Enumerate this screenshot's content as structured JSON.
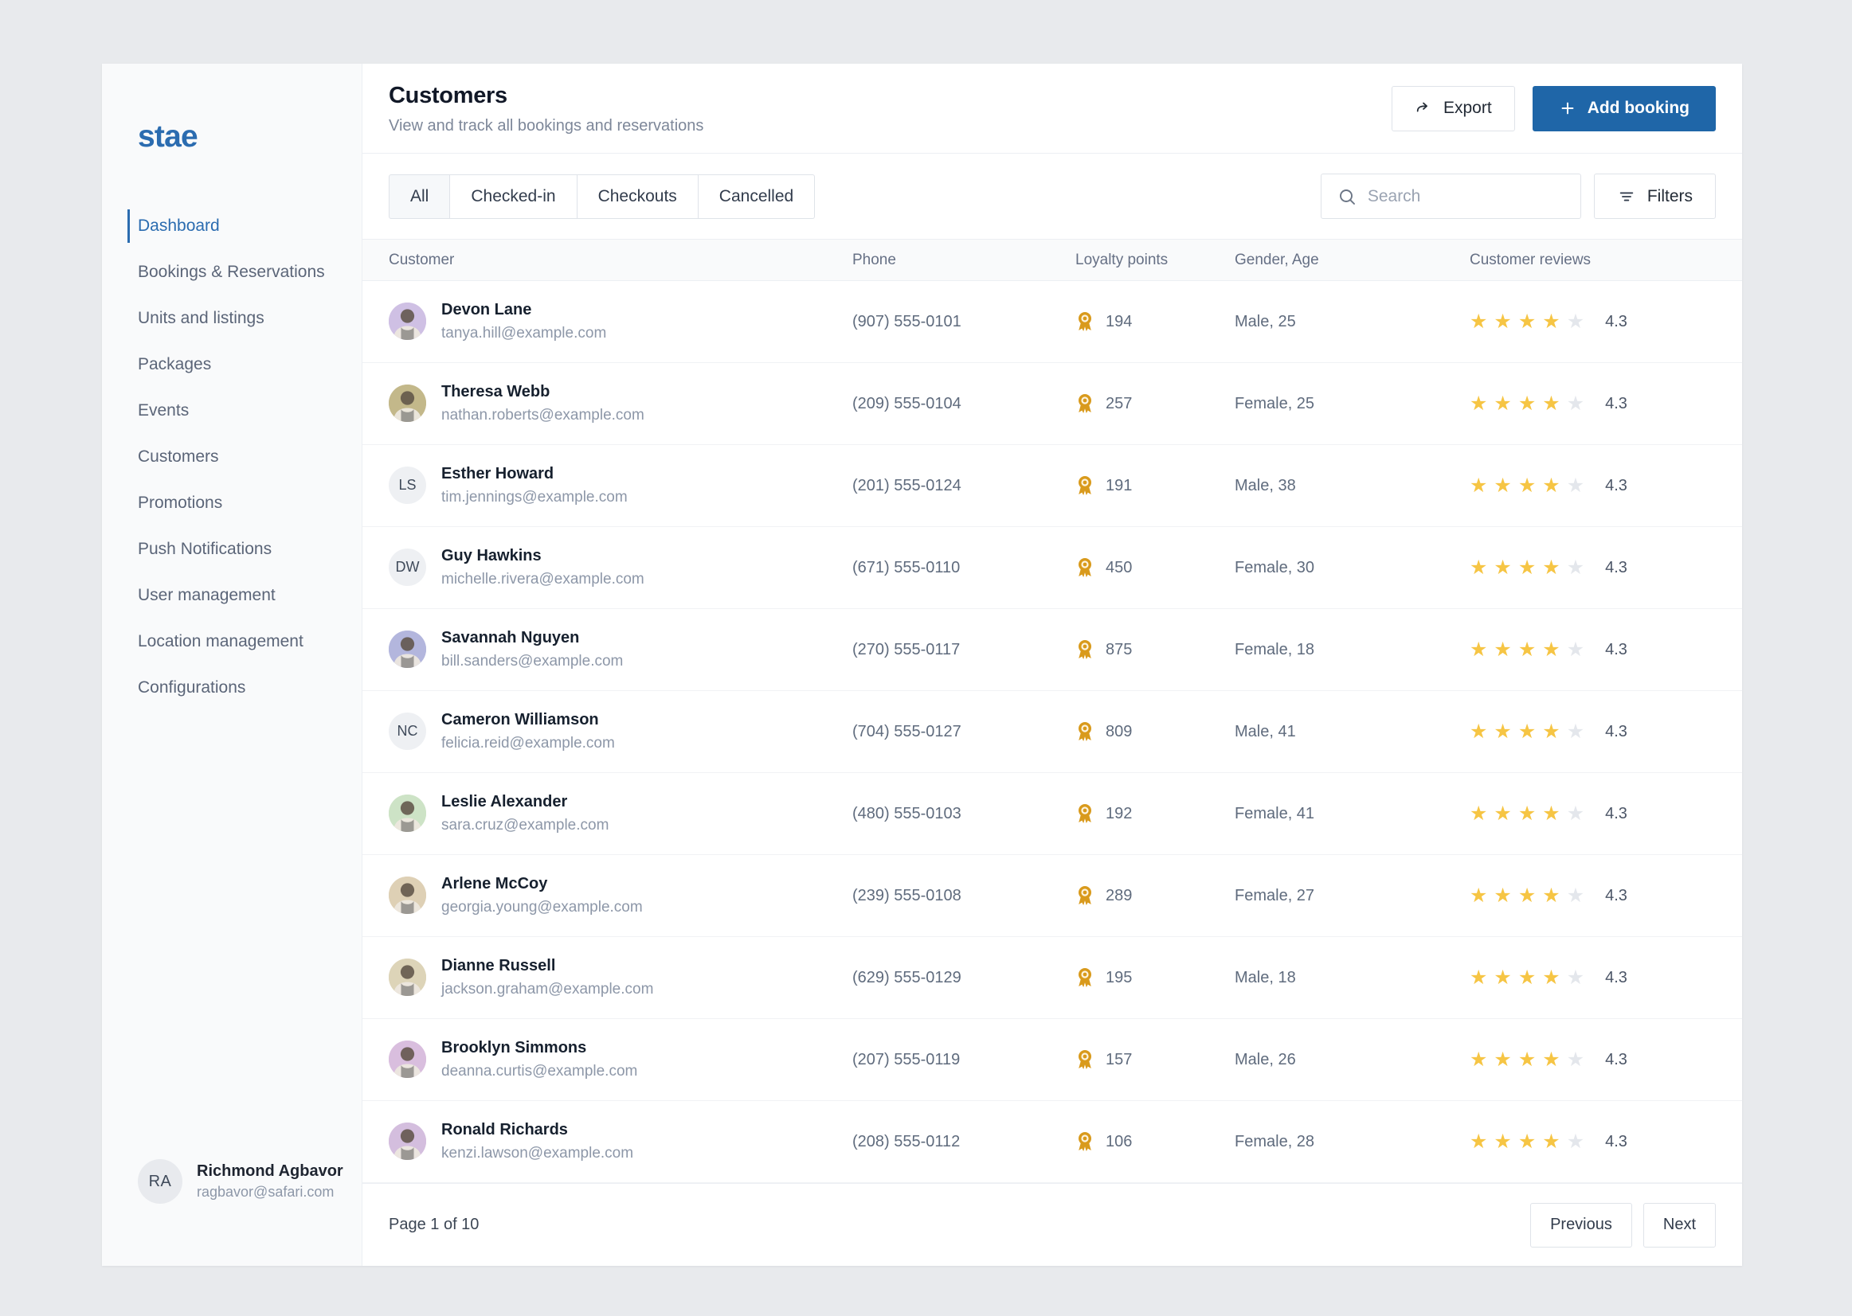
{
  "brand": {
    "logo_text": "stae"
  },
  "sidebar": {
    "items": [
      {
        "label": "Dashboard",
        "active": true
      },
      {
        "label": "Bookings & Reservations",
        "active": false
      },
      {
        "label": "Units and listings",
        "active": false
      },
      {
        "label": "Packages",
        "active": false
      },
      {
        "label": "Events",
        "active": false
      },
      {
        "label": "Customers",
        "active": false
      },
      {
        "label": "Promotions",
        "active": false
      },
      {
        "label": "Push Notifications",
        "active": false
      },
      {
        "label": "User management",
        "active": false
      },
      {
        "label": "Location management",
        "active": false
      },
      {
        "label": "Configurations",
        "active": false
      }
    ],
    "profile": {
      "initials": "RA",
      "name": "Richmond Agbavor",
      "email": "ragbavor@safari.com"
    }
  },
  "header": {
    "title": "Customers",
    "subtitle": "View and track all bookings and reservations",
    "export_label": "Export",
    "add_booking_label": "Add booking"
  },
  "toolbar": {
    "tabs": [
      {
        "label": "All",
        "active": true
      },
      {
        "label": "Checked-in",
        "active": false
      },
      {
        "label": "Checkouts",
        "active": false
      },
      {
        "label": "Cancelled",
        "active": false
      }
    ],
    "search": {
      "value": "",
      "placeholder": "Search"
    },
    "filters_label": "Filters"
  },
  "table": {
    "columns": [
      "Customer",
      "Phone",
      "Loyalty points",
      "Gender, Age",
      "Customer reviews"
    ],
    "rows": [
      {
        "name": "Devon Lane",
        "email": "tanya.hill@example.com",
        "phone": "(907) 555-0101",
        "loyalty": "194",
        "gender_age": "Male, 25",
        "stars_filled": 4,
        "rating": "4.3",
        "avatar_type": "photo",
        "avatar_bg": "#cfc0e4",
        "initials": ""
      },
      {
        "name": "Theresa Webb",
        "email": "nathan.roberts@example.com",
        "phone": "(209) 555-0104",
        "loyalty": "257",
        "gender_age": "Female, 25",
        "stars_filled": 4,
        "rating": "4.3",
        "avatar_type": "photo",
        "avatar_bg": "#c3b88a",
        "initials": ""
      },
      {
        "name": "Esther Howard",
        "email": "tim.jennings@example.com",
        "phone": "(201) 555-0124",
        "loyalty": "191",
        "gender_age": "Male, 38",
        "stars_filled": 4,
        "rating": "4.3",
        "avatar_type": "initials",
        "avatar_bg": "#eef0f3",
        "initials": "LS"
      },
      {
        "name": "Guy Hawkins",
        "email": "michelle.rivera@example.com",
        "phone": "(671) 555-0110",
        "loyalty": "450",
        "gender_age": "Female, 30",
        "stars_filled": 4,
        "rating": "4.3",
        "avatar_type": "initials",
        "avatar_bg": "#eef0f3",
        "initials": "DW"
      },
      {
        "name": "Savannah Nguyen",
        "email": "bill.sanders@example.com",
        "phone": "(270) 555-0117",
        "loyalty": "875",
        "gender_age": "Female, 18",
        "stars_filled": 4,
        "rating": "4.3",
        "avatar_type": "photo",
        "avatar_bg": "#b3b6dd",
        "initials": ""
      },
      {
        "name": "Cameron Williamson",
        "email": "felicia.reid@example.com",
        "phone": "(704) 555-0127",
        "loyalty": "809",
        "gender_age": "Male, 41",
        "stars_filled": 4,
        "rating": "4.3",
        "avatar_type": "initials",
        "avatar_bg": "#eef0f3",
        "initials": "NC"
      },
      {
        "name": "Leslie Alexander",
        "email": "sara.cruz@example.com",
        "phone": "(480) 555-0103",
        "loyalty": "192",
        "gender_age": "Female, 41",
        "stars_filled": 4,
        "rating": "4.3",
        "avatar_type": "photo",
        "avatar_bg": "#cde3c6",
        "initials": ""
      },
      {
        "name": "Arlene McCoy",
        "email": "georgia.young@example.com",
        "phone": "(239) 555-0108",
        "loyalty": "289",
        "gender_age": "Female, 27",
        "stars_filled": 4,
        "rating": "4.3",
        "avatar_type": "photo",
        "avatar_bg": "#ded0b5",
        "initials": ""
      },
      {
        "name": "Dianne Russell",
        "email": "jackson.graham@example.com",
        "phone": "(629) 555-0129",
        "loyalty": "195",
        "gender_age": "Male, 18",
        "stars_filled": 4,
        "rating": "4.3",
        "avatar_type": "photo",
        "avatar_bg": "#ddd4b8",
        "initials": ""
      },
      {
        "name": "Brooklyn Simmons",
        "email": "deanna.curtis@example.com",
        "phone": "(207) 555-0119",
        "loyalty": "157",
        "gender_age": "Male, 26",
        "stars_filled": 4,
        "rating": "4.3",
        "avatar_type": "photo",
        "avatar_bg": "#d9bede",
        "initials": ""
      },
      {
        "name": "Ronald Richards",
        "email": "kenzi.lawson@example.com",
        "phone": "(208) 555-0112",
        "loyalty": "106",
        "gender_age": "Female, 28",
        "stars_filled": 4,
        "rating": "4.3",
        "avatar_type": "photo",
        "avatar_bg": "#d4bede",
        "initials": ""
      }
    ]
  },
  "pagination": {
    "page_info": "Page 1 of 10",
    "previous_label": "Previous",
    "next_label": "Next"
  },
  "colors": {
    "accent": "#1f66a8",
    "brand": "#2b6cb0",
    "star_filled": "#f6c544",
    "star_empty": "#e4e7ec",
    "loyalty_icon": "#d99a1c",
    "page_bg": "#e8eaed"
  }
}
